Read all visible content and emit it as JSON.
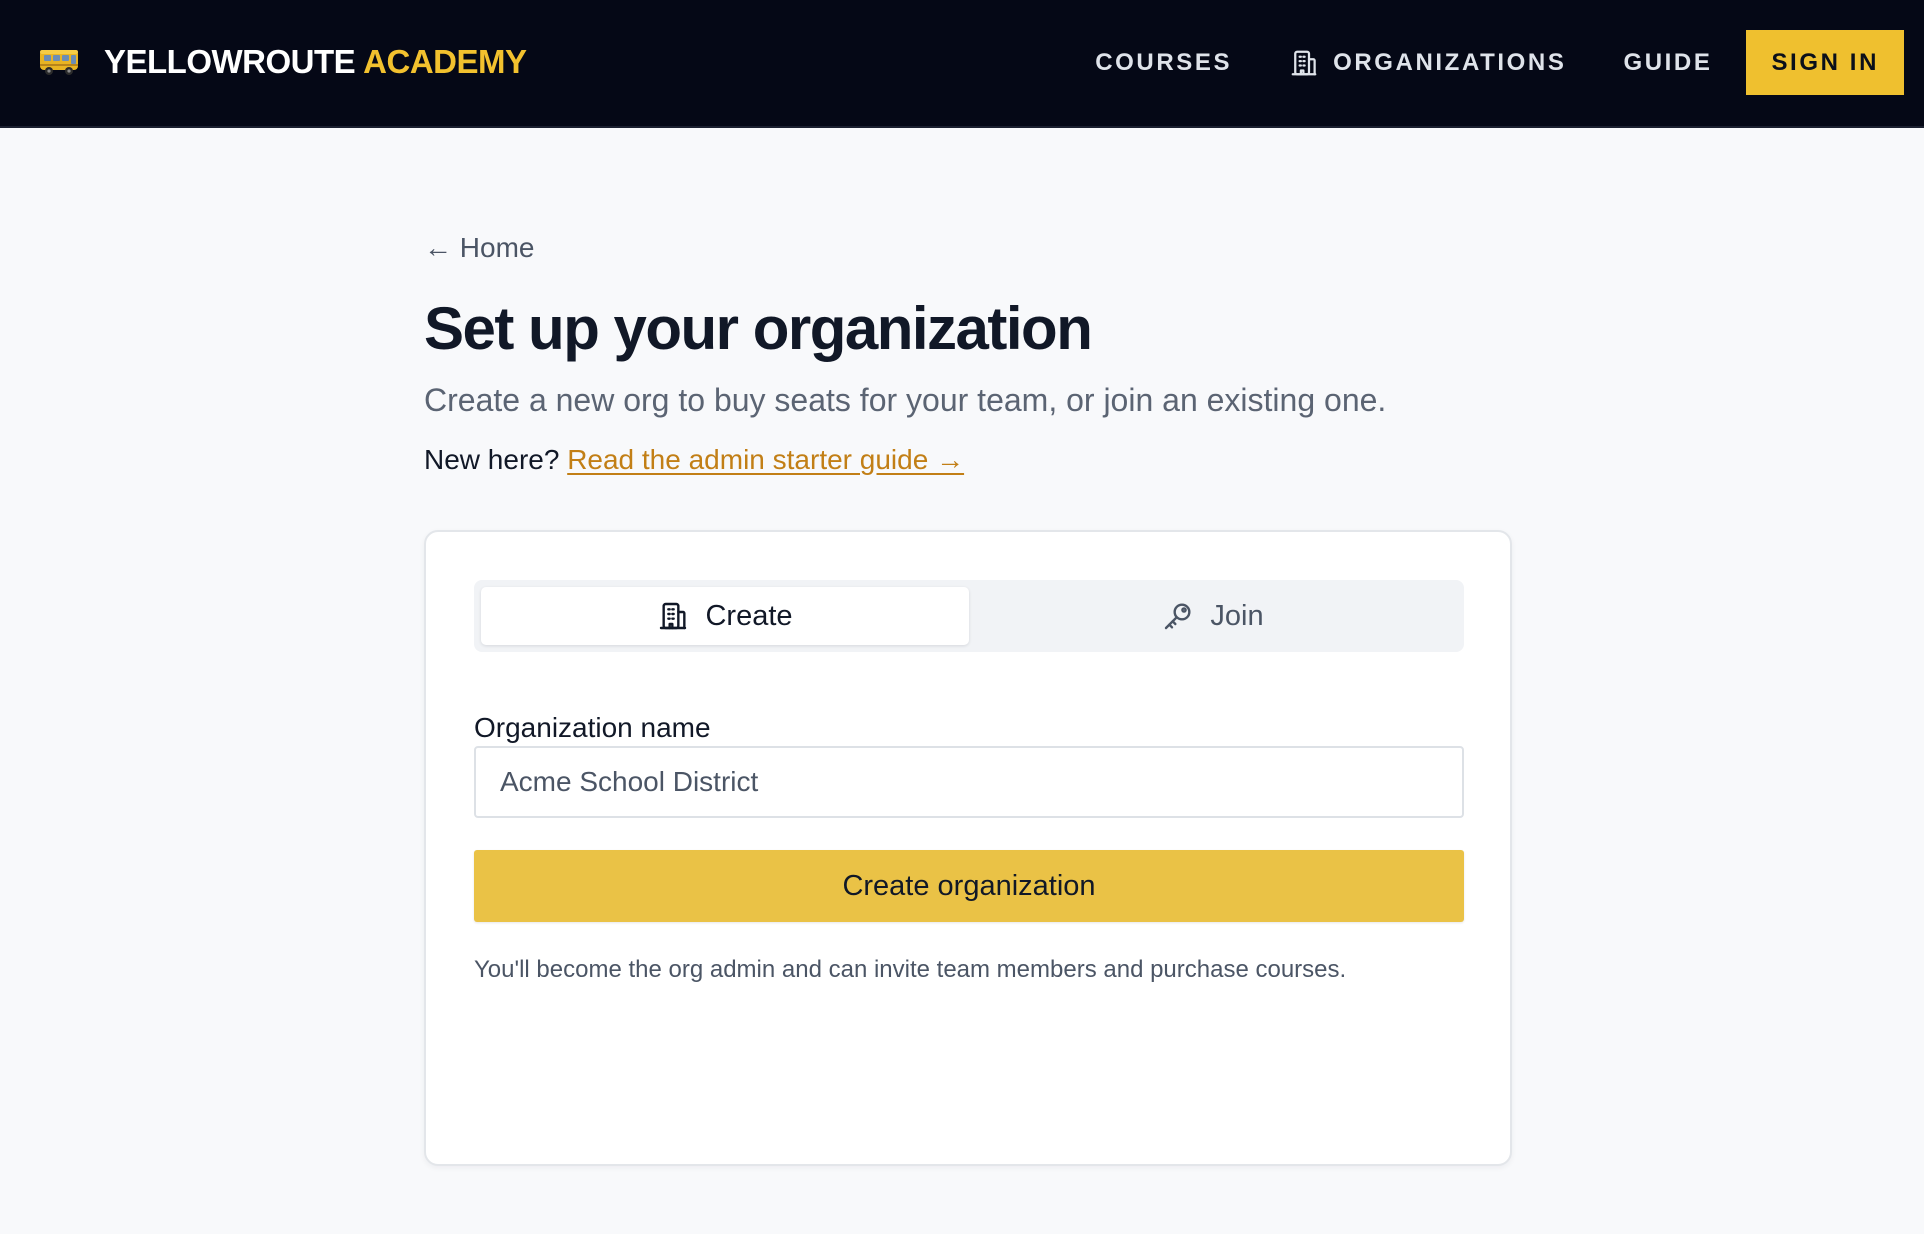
{
  "header": {
    "brand": {
      "name": "YELLOWROUTE",
      "accent": "ACADEMY",
      "icon": "school-bus-icon"
    },
    "nav": [
      {
        "label": "COURSES",
        "icon": null
      },
      {
        "label": "ORGANIZATIONS",
        "icon": "building-icon"
      },
      {
        "label": "GUIDE",
        "icon": null
      }
    ],
    "signin_label": "SIGN IN"
  },
  "main": {
    "back_link": "← Home",
    "title": "Set up your organization",
    "subtitle": "Create a new org to buy seats for your team, or join an existing one.",
    "guide_prompt": "New here?",
    "guide_link": "Read the admin starter guide →"
  },
  "card": {
    "tabs": [
      {
        "label": "Create",
        "icon": "building-icon",
        "active": true
      },
      {
        "label": "Join",
        "icon": "key-icon",
        "active": false
      }
    ],
    "field_label": "Organization name",
    "field_placeholder": "Acme School District",
    "field_value": "",
    "submit_label": "Create organization",
    "helper_text": "You'll become the org admin and can invite team members and purchase courses."
  },
  "colors": {
    "header_bg": "#050816",
    "brand_accent": "#f2c12e",
    "signin_bg": "#efc02f",
    "primary_button": "#eac246",
    "link": "#c27f16",
    "page_bg": "#f8f9fb"
  }
}
